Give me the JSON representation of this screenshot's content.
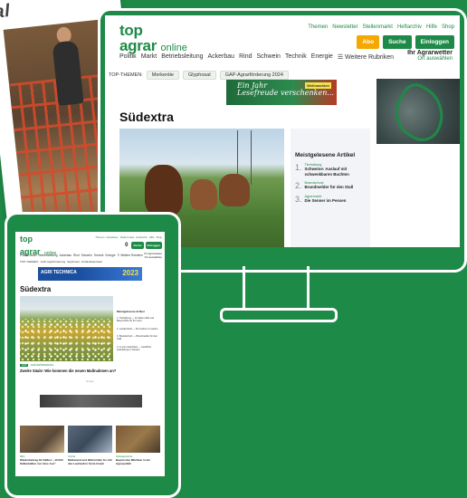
{
  "magazine": {
    "heading": "al"
  },
  "desktop": {
    "logo": {
      "line1": "top",
      "line2": "agrar",
      "suffix": "online"
    },
    "util_links": [
      "Themen",
      "Newsletter",
      "Stellenmarkt",
      "Heftarchiv",
      "Hilfe",
      "Shop"
    ],
    "buttons": {
      "abo": "Abo",
      "search": "Suche",
      "login": "Einloggen"
    },
    "nav": [
      "Politik",
      "Markt",
      "Betriebsleitung",
      "Ackerbau",
      "Rind",
      "Schwein",
      "Technik",
      "Energie",
      "☰ Weitere Rubriken"
    ],
    "weather": {
      "title": "Ihr Agrarwetter",
      "link": "Ort auswählen"
    },
    "topics_label": "TOP-THEMEN:",
    "topics": [
      "Merkentie",
      "Glyphosat",
      "GAP-Agrarförderung 2024"
    ],
    "banner": {
      "line1": "Ein Jahr",
      "line2": "Lesefreude verschenken...",
      "badge": "Weihnachten"
    },
    "page_title": "Südextra",
    "sidebar": {
      "heading": "Meistgelesene Artikel",
      "items": [
        {
          "num": "1.",
          "kicker": "Tierhaltung",
          "title": "Schweine: Auslauf mit schwenkbaren Buchten"
        },
        {
          "num": "2.",
          "kicker": "Brandschutz",
          "title": "Brandmelder für den Stall"
        },
        {
          "num": "3.",
          "kicker": "Agrarmarkt",
          "title": "Die Senner im Pessen"
        }
      ]
    }
  },
  "tablet": {
    "logo": {
      "line1": "top",
      "line2": "agrar",
      "suffix": "online"
    },
    "util_links": [
      "Themen",
      "Newsletter",
      "Stellenmarkt",
      "Heftarchiv",
      "Hilfe",
      "Shop"
    ],
    "abo_num": "0",
    "buttons": {
      "search": "Suche",
      "login": "Einloggen"
    },
    "nav": [
      "Politik",
      "Markt",
      "Betriebsleitung",
      "Ackerbau",
      "Rind",
      "Schwein",
      "Technik",
      "Energie",
      "☰ Weitere Rubriken"
    ],
    "weather": {
      "title": "Ihr Agrarwetter",
      "link": "Ort auswählen"
    },
    "topics_label": "TOP-THEMEN:",
    "topics": [
      "GAP-Agrarförderung",
      "Glyphosat",
      "Antibiotikaeinsatz"
    ],
    "banner": {
      "line1": "AGRI TECHNICA",
      "line2": "2023"
    },
    "page_title": "Südextra",
    "sidebar": {
      "heading": "Meistgelesene Artikel",
      "items": [
        "1. Tierhaltung — 10 Jahre Höfe und Bauernhöfe für Ihr Land",
        "2. Landtechnik — Pro Fahrer im Garten",
        "3. Brandschutz — Brandmelder für den Stall",
        "4. In eine Gleichheit — Ländliche Ausbildung im Norden"
      ]
    },
    "tag": {
      "label": "GAP",
      "text": "AGRARFÖRDERUNG"
    },
    "headline": "Zweite Säule: Wie kommen die neuen Maßnahmen an?",
    "ad_label": "Anzeige",
    "cards": [
      {
        "tag": "Milch",
        "text": "Wiederbeitrag für Kälber: „10.000 Kälberkälber nur ohne Aus“"
      },
      {
        "tag": "Technik",
        "text": "Melkstand und Wehrmittel: Es tritt den Laufstall in Sorte hinein"
      },
      {
        "tag": "Südstaatenküche",
        "text": "Bayerische Milchbar in der Agrarpolitik"
      }
    ]
  }
}
